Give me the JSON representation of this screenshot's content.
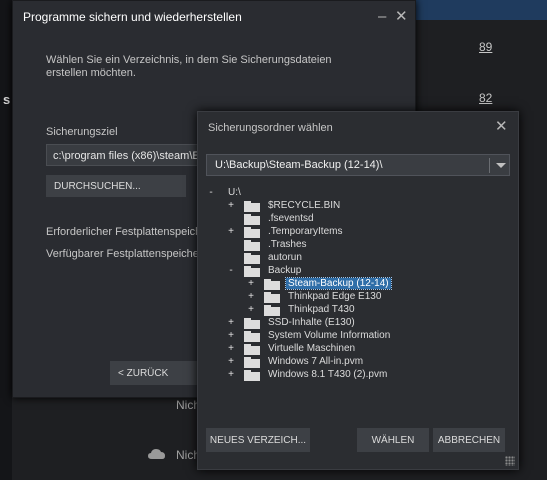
{
  "background": {
    "link_top": "89",
    "link_mid": "82",
    "side_letter": "s",
    "lower_text_1": "Nich",
    "lower_text_2": "Nich"
  },
  "backup_dialog": {
    "title": "Programme sichern und wiederherstellen",
    "description": "Wählen Sie ein Verzeichnis, in dem Sie Sicherungsdateien erstellen möchten.",
    "target_label": "Sicherungsziel",
    "target_value": "c:\\program files (x86)\\steam\\E",
    "browse_button": "DURCHSUCHEN...",
    "required_space_label": "Erforderlicher Festplattenspeich",
    "available_space_label": "Verfügbarer Festplattenspeiche",
    "back_button": "< ZURÜCK"
  },
  "folder_dialog": {
    "title": "Sicherungsordner wählen",
    "current_path": "U:\\Backup\\Steam-Backup (12-14)\\",
    "root": {
      "expander": "-",
      "label": "U:\\"
    },
    "tree": [
      {
        "expander": "+",
        "label": "$RECYCLE.BIN"
      },
      {
        "expander": "",
        "label": ".fseventsd"
      },
      {
        "expander": "+",
        "label": ".TemporaryItems"
      },
      {
        "expander": "",
        "label": ".Trashes"
      },
      {
        "expander": "",
        "label": "autorun"
      },
      {
        "expander": "-",
        "label": "Backup"
      },
      {
        "expander": "+",
        "label": "Steam-Backup (12-14)"
      },
      {
        "expander": "+",
        "label": "Thinkpad Edge E130"
      },
      {
        "expander": "+",
        "label": "Thinkpad T430"
      },
      {
        "expander": "+",
        "label": "SSD-Inhalte (E130)"
      },
      {
        "expander": "+",
        "label": "System Volume Information"
      },
      {
        "expander": "+",
        "label": "Virtuelle Maschinen"
      },
      {
        "expander": "+",
        "label": "Windows 7 All-in.pvm"
      },
      {
        "expander": "+",
        "label": "Windows 8.1 T430 (2).pvm"
      }
    ],
    "new_folder_button": "NEUES VERZEICH...",
    "choose_button": "WÄHLEN",
    "cancel_button": "ABBRECHEN"
  },
  "colors": {
    "dialog_bg": "#2a2c31",
    "selection": "#2f6ea8",
    "text": "#c6c6c6"
  }
}
